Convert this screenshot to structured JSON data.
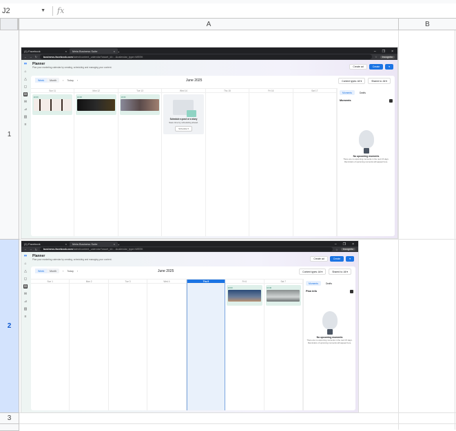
{
  "sheet": {
    "name_box": "J2",
    "fx_icon": "fx",
    "columns": [
      "A",
      "B"
    ],
    "rows": [
      "1",
      "2",
      "3"
    ]
  },
  "shot1": {
    "tabs": [
      "(1) Facebook",
      "Meta Business Suite"
    ],
    "url_host": "business.facebook.com",
    "url_path": "/latest/content_calendar?asset_id=...&calendar_type=WEEK",
    "incognito": "Incognito",
    "title": "Planner",
    "subtitle": "Plan your marketing calendar by creating, scheduling and managing your content.",
    "create_ad": "Create ad",
    "create": "Create",
    "week": "Week",
    "month_btn": "Month",
    "today": "Today",
    "month": "June 2025",
    "filter1": "Content types: All ▾",
    "filter2": "Shared to: All ▾",
    "days": [
      "Sun 11",
      "Mon 12",
      "Tue 13",
      "Wed 14",
      "Thu 15",
      "Fri 16",
      "Sat 17"
    ],
    "post_time": "10:00",
    "empty_title": "Schedule a post or a story",
    "empty_sub": "Save time by scheduling ahead.",
    "schedule": "Schedule ▾",
    "rtab1": "Moments",
    "rtab2": "Drafts",
    "moments": "Moments",
    "no_moments": "No upcoming moments",
    "no_moments_sub": "There are no upcoming moments in the next 15 days. Reminders of upcoming moments will appear here."
  },
  "shot2": {
    "tabs": [
      "(1) Facebook",
      "Meta Business Suite"
    ],
    "url_host": "business.facebook.com",
    "url_path": "/latest/content_calendar?asset_id=...&calendar_type=WEEK",
    "incognito": "Incognito",
    "title": "Planner",
    "subtitle": "Plan your marketing calendar by creating, scheduling and managing your content.",
    "create_ad": "Create ad",
    "create": "Create",
    "week": "Week",
    "month_btn": "Month",
    "today": "Today",
    "month": "June 2025",
    "filter1": "Content types: All ▾",
    "filter2": "Shared to: All ▾",
    "days": [
      "Sun 1",
      "Mon 2",
      "Tue 3",
      "Wed 4",
      "Thu 5",
      "Fri 6",
      "Sat 7"
    ],
    "post_time": "10:00",
    "rtab1": "Moments",
    "rtab2": "Drafts",
    "moments": "Plan info",
    "no_moments": "No upcoming moments",
    "no_moments_sub": "There are no upcoming moments in the next 15 days. Reminders of upcoming moments will appear here."
  }
}
